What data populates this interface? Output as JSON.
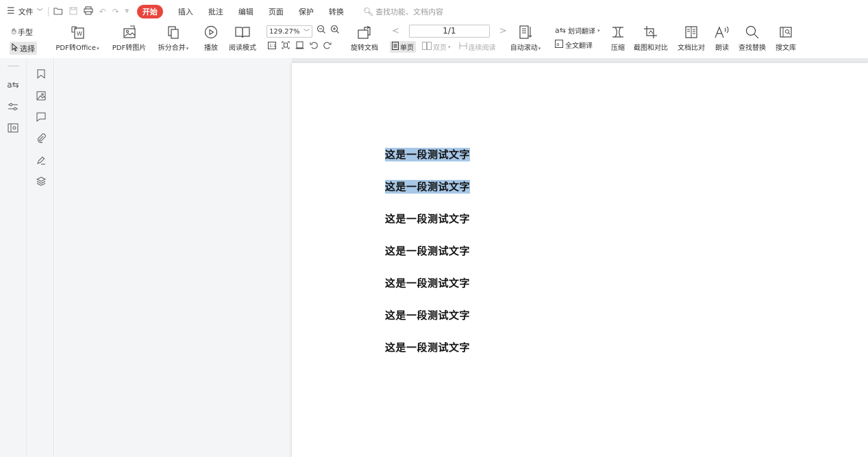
{
  "menubar": {
    "file_label": "文件",
    "tabs": {
      "start": "开始",
      "insert": "插入",
      "annotate": "批注",
      "edit": "编辑",
      "page": "页面",
      "protect": "保护",
      "convert": "转换"
    },
    "search_placeholder": "查找功能、文档内容"
  },
  "ribbon": {
    "hand": "手型",
    "select": "选择",
    "pdf_to_office": "PDF转Office",
    "pdf_to_image": "PDF转图片",
    "split_merge": "拆分合并",
    "play": "播放",
    "read_mode": "阅读模式",
    "zoom_value": "129.27%",
    "rotate_doc": "旋转文档",
    "page_indicator": "1/1",
    "single_page": "单页",
    "double_page": "双页",
    "continuous_read": "连续阅读",
    "auto_scroll": "自动滚动",
    "word_translate": "划词翻译",
    "full_translate": "全文翻译",
    "compress": "压缩",
    "screenshot_compare": "截图和对比",
    "doc_compare": "文档比对",
    "read_aloud": "朗读",
    "find_replace": "查找替换",
    "search_library": "搜文库"
  },
  "document": {
    "lines": [
      "这是一段测试文字",
      "这是一段测试文字",
      "这是一段测试文字",
      "这是一段测试文字",
      "这是一段测试文字",
      "这是一段测试文字",
      "这是一段测试文字"
    ],
    "selected_lines": 2
  },
  "colors": {
    "accent_red": "#e8453c",
    "selection": "#a7c7e7",
    "sidebar_bg": "#f4f5f7"
  }
}
